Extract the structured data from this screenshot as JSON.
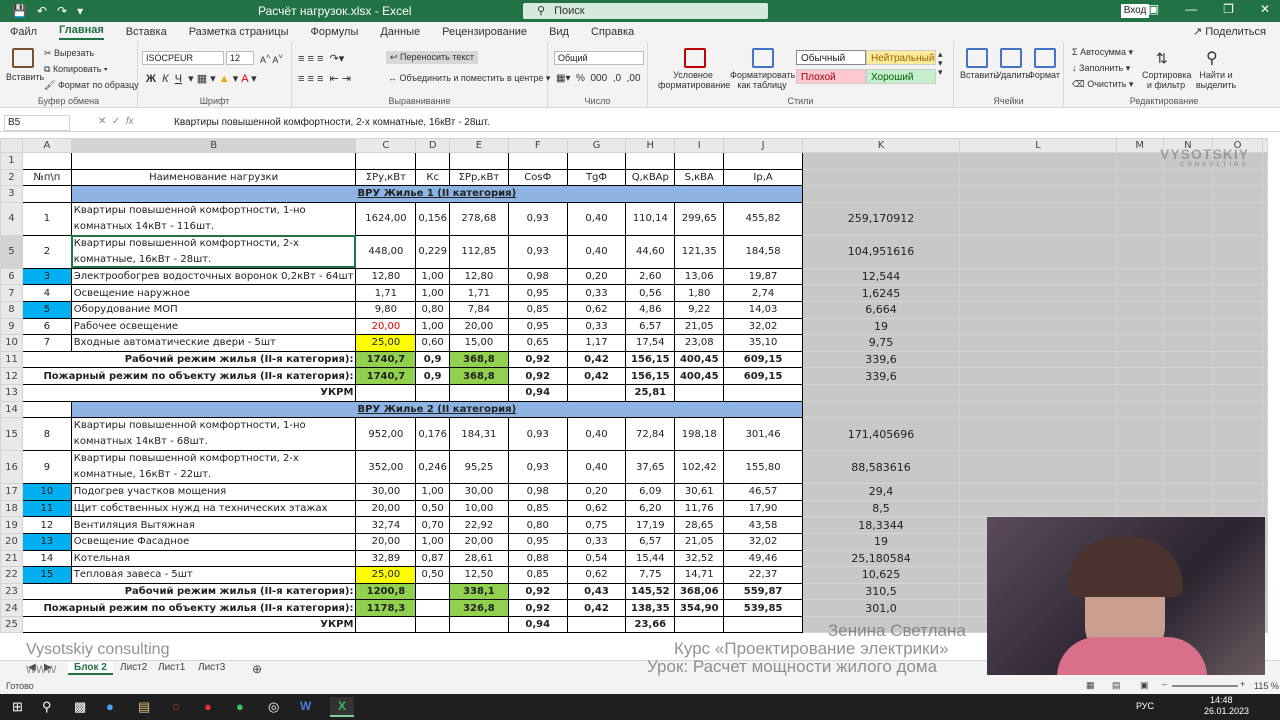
{
  "titlebar": {
    "doc_title": "Расчёт нагрузок.xlsx  -  Excel",
    "search_placeholder": "Поиск",
    "login": "Вход"
  },
  "tabs": [
    "Файл",
    "Главная",
    "Вставка",
    "Разметка страницы",
    "Формулы",
    "Данные",
    "Рецензирование",
    "Вид",
    "Справка"
  ],
  "share_label": "Поделиться",
  "ribbon": {
    "paste": "Вставить",
    "cut": "Вырезать",
    "copy": "Копировать",
    "format_painter": "Формат по образцу",
    "clipboard_group": "Буфер обмена",
    "font_name": "ISOCPEUR",
    "font_size": "12",
    "font_group": "Шрифт",
    "wrap_text": "Переносить текст",
    "merge_center": "Объединить и поместить в центре",
    "align_group": "Выравнивание",
    "number_format": "Общий",
    "number_group": "Число",
    "cond_format": "Условное форматирование",
    "format_table": "Форматировать как таблицу",
    "styles": {
      "normal": "Обычный",
      "neutral": "Нейтральный",
      "bad": "Плохой",
      "good": "Хороший"
    },
    "styles_group": "Стили",
    "insert": "Вставить",
    "delete": "Удалить",
    "format": "Формат",
    "cells_group": "Ячейки",
    "autosum": "Автосумма",
    "fill": "Заполнить",
    "clear": "Очистить",
    "sort_filter": "Сортировка и фильтр",
    "find_select": "Найти и выделить",
    "editing_group": "Редактирование"
  },
  "formula_bar": {
    "name_box": "B5",
    "fx": "fx",
    "formula": "Квартиры повышенной комфортности, 2-х комнатные, 16кВт - 28шт."
  },
  "columns": [
    "A",
    "B",
    "C",
    "D",
    "E",
    "F",
    "G",
    "H",
    "I",
    "J",
    "K",
    "L",
    "M",
    "N",
    "O"
  ],
  "headers": [
    "№п\\п",
    "Наименование нагрузки",
    "ΣРу,кВт",
    "Кс",
    "ΣРр,кВт",
    "CosФ",
    "TgФ",
    "Q,кВАр",
    "S,кВА",
    "Iр,А"
  ],
  "sections": {
    "s1": "ВРУ Жилье 1 (II категория)",
    "s2": "ВРУ Жилье 2 (II категория)"
  },
  "rows1": [
    {
      "n": "1",
      "name": "Квартиры повышенной комфортности,  1-но комнатных 14кВт - 116шт.",
      "py": "1624,00",
      "kc": "0,156",
      "pp": "278,68",
      "cos": "0,93",
      "tg": "0,40",
      "q": "110,14",
      "s": "299,65",
      "i": "455,82",
      "k": "259,170912"
    },
    {
      "n": "2",
      "name": "Квартиры повышенной комфортности,  2-х комнатные, 16кВт - 28шт.",
      "py": "448,00",
      "kc": "0,229",
      "pp": "112,85",
      "cos": "0,93",
      "tg": "0,40",
      "q": "44,60",
      "s": "121,35",
      "i": "184,58",
      "k": "104,951616"
    },
    {
      "n": "3",
      "name": "Электрообогрев водосточных воронок 0,2кВт - 64шт",
      "py": "12,80",
      "kc": "1,00",
      "pp": "12,80",
      "cos": "0,98",
      "tg": "0,20",
      "q": "2,60",
      "s": "13,06",
      "i": "19,87",
      "k": "12,544"
    },
    {
      "n": "4",
      "name": "Освещение наружное",
      "py": "1,71",
      "kc": "1,00",
      "pp": "1,71",
      "cos": "0,95",
      "tg": "0,33",
      "q": "0,56",
      "s": "1,80",
      "i": "2,74",
      "k": "1,6245"
    },
    {
      "n": "5",
      "name": "Оборудование МОП",
      "py": "9,80",
      "kc": "0,80",
      "pp": "7,84",
      "cos": "0,85",
      "tg": "0,62",
      "q": "4,86",
      "s": "9,22",
      "i": "14,03",
      "k": "6,664"
    },
    {
      "n": "6",
      "name": "Рабочее освещение",
      "py": "20,00",
      "kc": "1,00",
      "pp": "20,00",
      "cos": "0,95",
      "tg": "0,33",
      "q": "6,57",
      "s": "21,05",
      "i": "32,02",
      "k": "19"
    },
    {
      "n": "7",
      "name": "Входные автоматические двери - 5шт",
      "py": "25,00",
      "kc": "0,60",
      "pp": "15,00",
      "cos": "0,65",
      "tg": "1,17",
      "q": "17,54",
      "s": "23,08",
      "i": "35,10",
      "k": "9,75"
    }
  ],
  "totals1": {
    "work_label": "Рабочий режим жилья (II-я категория):",
    "work": {
      "py": "1740,7",
      "kc": "0,9",
      "pp": "368,8",
      "cos": "0,92",
      "tg": "0,42",
      "q": "156,15",
      "s": "400,45",
      "i": "609,15",
      "k": "339,6"
    },
    "fire_label": "Пожарный режим по объекту жилья (II-я категория):",
    "fire": {
      "py": "1740,7",
      "kc": "0,9",
      "pp": "368,8",
      "cos": "0,92",
      "tg": "0,42",
      "q": "156,15",
      "s": "400,45",
      "i": "609,15",
      "k": "339,6"
    },
    "ukrm_label": "УКРМ",
    "ukrm": {
      "cos": "0,94",
      "q": "25,81"
    }
  },
  "rows2": [
    {
      "n": "8",
      "name": "Квартиры повышенной комфортности,  1-но комнатных 14кВт - 68шт.",
      "py": "952,00",
      "kc": "0,176",
      "pp": "184,31",
      "cos": "0,93",
      "tg": "0,40",
      "q": "72,84",
      "s": "198,18",
      "i": "301,46",
      "k": "171,405696"
    },
    {
      "n": "9",
      "name": "Квартиры повышенной комфортности,  2-х комнатные, 16кВт - 22шт.",
      "py": "352,00",
      "kc": "0,246",
      "pp": "95,25",
      "cos": "0,93",
      "tg": "0,40",
      "q": "37,65",
      "s": "102,42",
      "i": "155,80",
      "k": "88,583616"
    },
    {
      "n": "10",
      "name": "Подогрев участков мощения",
      "py": "30,00",
      "kc": "1,00",
      "pp": "30,00",
      "cos": "0,98",
      "tg": "0,20",
      "q": "6,09",
      "s": "30,61",
      "i": "46,57",
      "k": "29,4"
    },
    {
      "n": "11",
      "name": "Щит собственных нужд на технических этажах",
      "py": "20,00",
      "kc": "0,50",
      "pp": "10,00",
      "cos": "0,85",
      "tg": "0,62",
      "q": "6,20",
      "s": "11,76",
      "i": "17,90",
      "k": "8,5"
    },
    {
      "n": "12",
      "name": "Вентиляция Вытяжная",
      "py": "32,74",
      "kc": "0,70",
      "pp": "22,92",
      "cos": "0,80",
      "tg": "0,75",
      "q": "17,19",
      "s": "28,65",
      "i": "43,58",
      "k": "18,3344"
    },
    {
      "n": "13",
      "name": "Освещение Фасадное",
      "py": "20,00",
      "kc": "1,00",
      "pp": "20,00",
      "cos": "0,95",
      "tg": "0,33",
      "q": "6,57",
      "s": "21,05",
      "i": "32,02",
      "k": "19"
    },
    {
      "n": "14",
      "name": "Котельная",
      "py": "32,89",
      "kc": "0,87",
      "pp": "28,61",
      "cos": "0,88",
      "tg": "0,54",
      "q": "15,44",
      "s": "32,52",
      "i": "49,46",
      "k": "25,180584"
    },
    {
      "n": "15",
      "name": "Тепловая завеса - 5шт",
      "py": "25,00",
      "kc": "0,50",
      "pp": "12,50",
      "cos": "0,85",
      "tg": "0,62",
      "q": "7,75",
      "s": "14,71",
      "i": "22,37",
      "k": "10,625"
    }
  ],
  "totals2": {
    "work_label": "Рабочий режим жилья (II-я категория):",
    "work": {
      "py": "1200,8",
      "pp": "338,1",
      "cos": "0,92",
      "tg": "0,43",
      "q": "145,52",
      "s": "368,06",
      "i": "559,87",
      "k": "310,5"
    },
    "fire_label": "Пожарный режим по объекту жилья (II-я категория):",
    "fire": {
      "py": "1178,3",
      "pp": "326,8",
      "cos": "0,92",
      "tg": "0,42",
      "q": "138,35",
      "s": "354,90",
      "i": "539,85",
      "k": "301,0"
    },
    "ukrm_label": "УКРМ",
    "ukrm": {
      "cos": "0,94",
      "q": "23,66"
    }
  },
  "sheet_tabs": [
    "Блок 2",
    "Лист2",
    "Лист1",
    "Лист3"
  ],
  "status": {
    "ready": "Готово",
    "zoom": "115 %"
  },
  "taskbar": {
    "lang": "РУС",
    "time": "14:48",
    "date": "26.01.2023"
  },
  "overlay": {
    "logo": "VYSOTSKIY",
    "logo_sub": "CONSULTING",
    "watermark_left": "Vysotskiy consulting",
    "watermark_left2": "www",
    "name": "Зенина Светлана",
    "course": "Курс «Проектирование электрики»",
    "lesson": "Урок: Расчет мощности жилого дома"
  }
}
